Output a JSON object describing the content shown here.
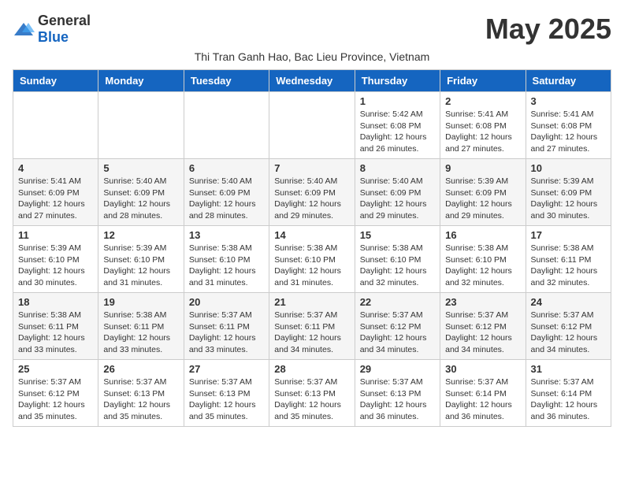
{
  "header": {
    "logo_general": "General",
    "logo_blue": "Blue",
    "month_year": "May 2025",
    "location": "Thi Tran Ganh Hao, Bac Lieu Province, Vietnam"
  },
  "weekdays": [
    "Sunday",
    "Monday",
    "Tuesday",
    "Wednesday",
    "Thursday",
    "Friday",
    "Saturday"
  ],
  "weeks": [
    [
      {
        "day": "",
        "info": ""
      },
      {
        "day": "",
        "info": ""
      },
      {
        "day": "",
        "info": ""
      },
      {
        "day": "",
        "info": ""
      },
      {
        "day": "1",
        "info": "Sunrise: 5:42 AM\nSunset: 6:08 PM\nDaylight: 12 hours\nand 26 minutes."
      },
      {
        "day": "2",
        "info": "Sunrise: 5:41 AM\nSunset: 6:08 PM\nDaylight: 12 hours\nand 27 minutes."
      },
      {
        "day": "3",
        "info": "Sunrise: 5:41 AM\nSunset: 6:08 PM\nDaylight: 12 hours\nand 27 minutes."
      }
    ],
    [
      {
        "day": "4",
        "info": "Sunrise: 5:41 AM\nSunset: 6:09 PM\nDaylight: 12 hours\nand 27 minutes."
      },
      {
        "day": "5",
        "info": "Sunrise: 5:40 AM\nSunset: 6:09 PM\nDaylight: 12 hours\nand 28 minutes."
      },
      {
        "day": "6",
        "info": "Sunrise: 5:40 AM\nSunset: 6:09 PM\nDaylight: 12 hours\nand 28 minutes."
      },
      {
        "day": "7",
        "info": "Sunrise: 5:40 AM\nSunset: 6:09 PM\nDaylight: 12 hours\nand 29 minutes."
      },
      {
        "day": "8",
        "info": "Sunrise: 5:40 AM\nSunset: 6:09 PM\nDaylight: 12 hours\nand 29 minutes."
      },
      {
        "day": "9",
        "info": "Sunrise: 5:39 AM\nSunset: 6:09 PM\nDaylight: 12 hours\nand 29 minutes."
      },
      {
        "day": "10",
        "info": "Sunrise: 5:39 AM\nSunset: 6:09 PM\nDaylight: 12 hours\nand 30 minutes."
      }
    ],
    [
      {
        "day": "11",
        "info": "Sunrise: 5:39 AM\nSunset: 6:10 PM\nDaylight: 12 hours\nand 30 minutes."
      },
      {
        "day": "12",
        "info": "Sunrise: 5:39 AM\nSunset: 6:10 PM\nDaylight: 12 hours\nand 31 minutes."
      },
      {
        "day": "13",
        "info": "Sunrise: 5:38 AM\nSunset: 6:10 PM\nDaylight: 12 hours\nand 31 minutes."
      },
      {
        "day": "14",
        "info": "Sunrise: 5:38 AM\nSunset: 6:10 PM\nDaylight: 12 hours\nand 31 minutes."
      },
      {
        "day": "15",
        "info": "Sunrise: 5:38 AM\nSunset: 6:10 PM\nDaylight: 12 hours\nand 32 minutes."
      },
      {
        "day": "16",
        "info": "Sunrise: 5:38 AM\nSunset: 6:10 PM\nDaylight: 12 hours\nand 32 minutes."
      },
      {
        "day": "17",
        "info": "Sunrise: 5:38 AM\nSunset: 6:11 PM\nDaylight: 12 hours\nand 32 minutes."
      }
    ],
    [
      {
        "day": "18",
        "info": "Sunrise: 5:38 AM\nSunset: 6:11 PM\nDaylight: 12 hours\nand 33 minutes."
      },
      {
        "day": "19",
        "info": "Sunrise: 5:38 AM\nSunset: 6:11 PM\nDaylight: 12 hours\nand 33 minutes."
      },
      {
        "day": "20",
        "info": "Sunrise: 5:37 AM\nSunset: 6:11 PM\nDaylight: 12 hours\nand 33 minutes."
      },
      {
        "day": "21",
        "info": "Sunrise: 5:37 AM\nSunset: 6:11 PM\nDaylight: 12 hours\nand 34 minutes."
      },
      {
        "day": "22",
        "info": "Sunrise: 5:37 AM\nSunset: 6:12 PM\nDaylight: 12 hours\nand 34 minutes."
      },
      {
        "day": "23",
        "info": "Sunrise: 5:37 AM\nSunset: 6:12 PM\nDaylight: 12 hours\nand 34 minutes."
      },
      {
        "day": "24",
        "info": "Sunrise: 5:37 AM\nSunset: 6:12 PM\nDaylight: 12 hours\nand 34 minutes."
      }
    ],
    [
      {
        "day": "25",
        "info": "Sunrise: 5:37 AM\nSunset: 6:12 PM\nDaylight: 12 hours\nand 35 minutes."
      },
      {
        "day": "26",
        "info": "Sunrise: 5:37 AM\nSunset: 6:13 PM\nDaylight: 12 hours\nand 35 minutes."
      },
      {
        "day": "27",
        "info": "Sunrise: 5:37 AM\nSunset: 6:13 PM\nDaylight: 12 hours\nand 35 minutes."
      },
      {
        "day": "28",
        "info": "Sunrise: 5:37 AM\nSunset: 6:13 PM\nDaylight: 12 hours\nand 35 minutes."
      },
      {
        "day": "29",
        "info": "Sunrise: 5:37 AM\nSunset: 6:13 PM\nDaylight: 12 hours\nand 36 minutes."
      },
      {
        "day": "30",
        "info": "Sunrise: 5:37 AM\nSunset: 6:14 PM\nDaylight: 12 hours\nand 36 minutes."
      },
      {
        "day": "31",
        "info": "Sunrise: 5:37 AM\nSunset: 6:14 PM\nDaylight: 12 hours\nand 36 minutes."
      }
    ]
  ]
}
